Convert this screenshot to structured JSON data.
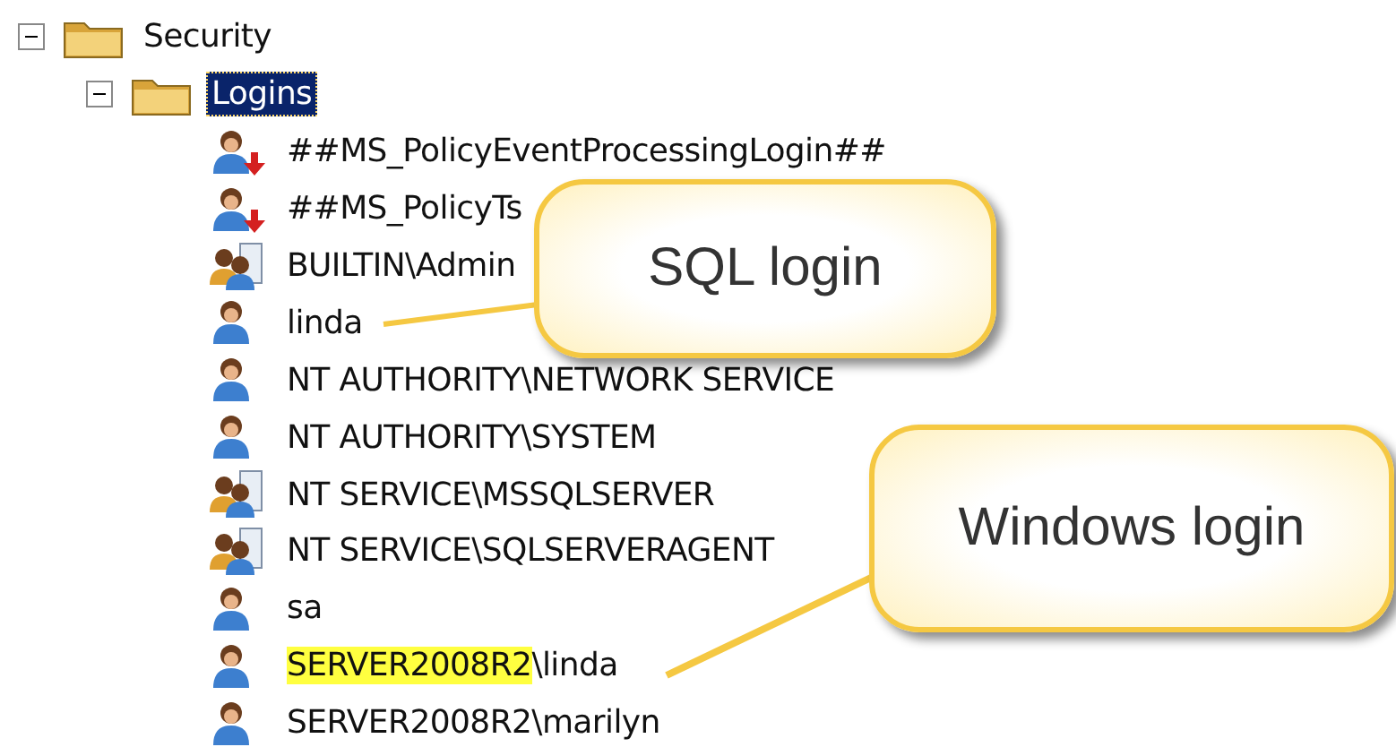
{
  "tree": [
    {
      "label": "Security",
      "expanded": true,
      "selected": false,
      "children": [
        {
          "label": "Logins",
          "expanded": true,
          "selected": true,
          "children": [
            {
              "kind": "login-disabled",
              "parts": [
                {
                  "text": "##MS_PolicyEventProcessingLogin##",
                  "highlighted": false
                }
              ]
            },
            {
              "kind": "login-disabled",
              "parts": [
                {
                  "text": "##MS_PolicyTs",
                  "highlighted": false
                }
              ]
            },
            {
              "kind": "group",
              "parts": [
                {
                  "text": "BUILTIN\\Admin",
                  "highlighted": false
                }
              ]
            },
            {
              "kind": "user",
              "parts": [
                {
                  "text": "linda",
                  "highlighted": false
                }
              ]
            },
            {
              "kind": "user",
              "parts": [
                {
                  "text": "NT AUTHORITY\\NETWORK SERVICE",
                  "highlighted": false
                }
              ]
            },
            {
              "kind": "user",
              "parts": [
                {
                  "text": "NT AUTHORITY\\SYSTEM",
                  "highlighted": false
                }
              ]
            },
            {
              "kind": "group",
              "parts": [
                {
                  "text": "NT SERVICE\\MSSQLSERVER",
                  "highlighted": false
                }
              ]
            },
            {
              "kind": "group",
              "parts": [
                {
                  "text": "NT SERVICE\\SQLSERVERAGENT",
                  "highlighted": false
                }
              ]
            },
            {
              "kind": "user",
              "parts": [
                {
                  "text": "sa",
                  "highlighted": false
                }
              ]
            },
            {
              "kind": "user",
              "parts": [
                {
                  "text": "SERVER2008R2",
                  "highlighted": true
                },
                {
                  "text": "\\linda",
                  "highlighted": false
                }
              ]
            },
            {
              "kind": "user",
              "parts": [
                {
                  "text": "SERVER2008R2\\marilyn",
                  "highlighted": false
                }
              ]
            }
          ]
        }
      ]
    }
  ],
  "callouts": [
    {
      "text": "SQL login"
    },
    {
      "text": "Windows login"
    }
  ]
}
